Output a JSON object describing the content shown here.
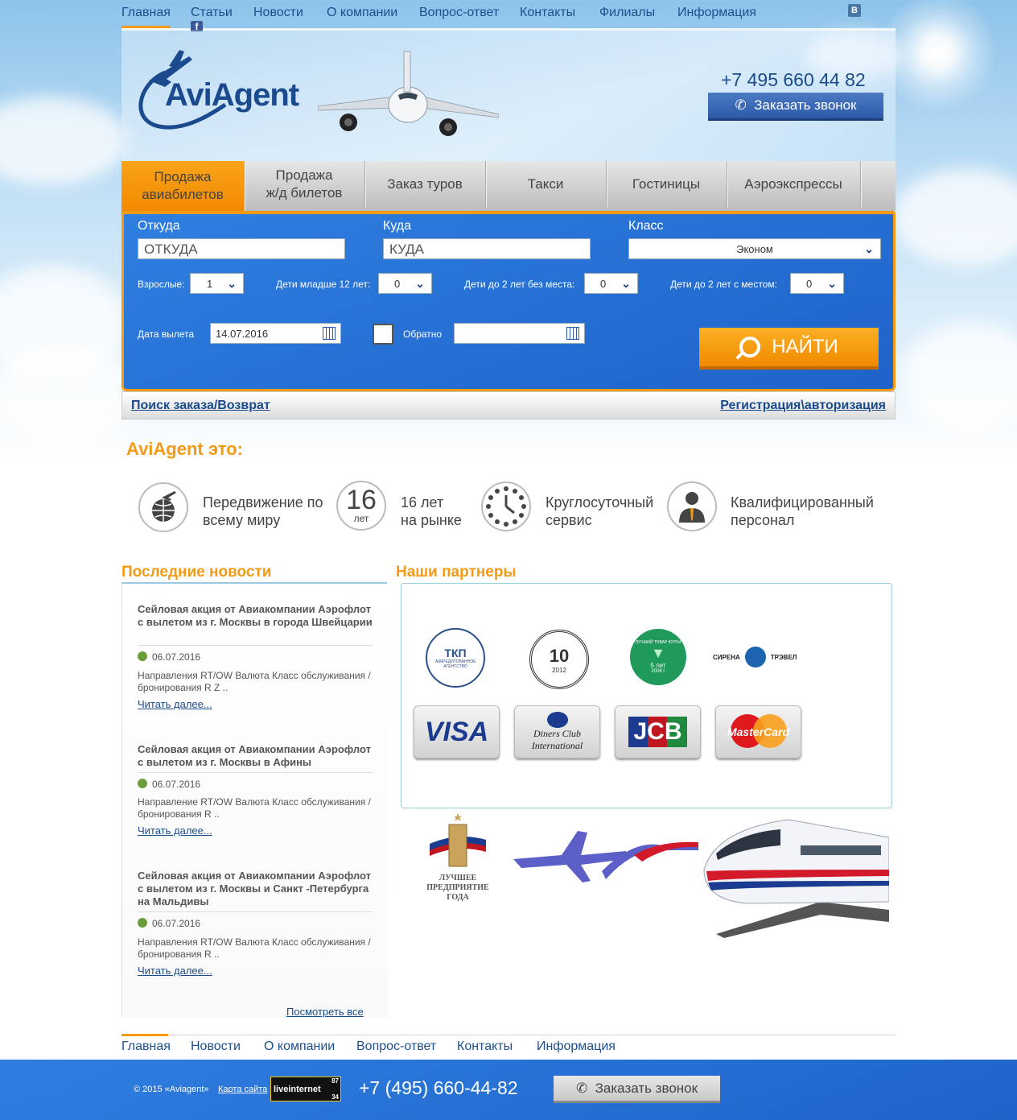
{
  "top_nav": [
    "Главная",
    "Статьи",
    "Новости",
    "О компании",
    "Вопрос-ответ",
    "Контакты",
    "Филиалы",
    "Информация"
  ],
  "social": {
    "vk": "В",
    "fb": "f"
  },
  "logo_text": "AviAgent",
  "phone": "+7 495 660 44 82",
  "callback_label": "Заказать звонок",
  "tabs": [
    {
      "line1": "Продажа",
      "line2": "авиабилетов"
    },
    {
      "line1": "Продажа",
      "line2": "ж/д билетов"
    },
    {
      "line1": "Заказ туров",
      "line2": ""
    },
    {
      "line1": "Такси",
      "line2": ""
    },
    {
      "line1": "Гостиницы",
      "line2": ""
    },
    {
      "line1": "Аэроэкспрессы",
      "line2": ""
    }
  ],
  "search": {
    "from_label": "Откуда",
    "from_placeholder": "ОТКУДА",
    "to_label": "Куда",
    "to_placeholder": "КУДА",
    "class_label": "Класс",
    "class_value": "Эконом",
    "adults_label": "Взрослые:",
    "adults_value": "1",
    "children12_label": "Дети младше 12 лет:",
    "children12_value": "0",
    "infants_noseat_label": "Дети до 2 лет без места:",
    "infants_noseat_value": "0",
    "infants_seat_label": "Дети до 2 лет с местом:",
    "infants_seat_value": "0",
    "depart_label": "Дата вылета",
    "depart_value": "14.07.2016",
    "return_label": "Обратно",
    "return_value": "",
    "find_label": "НАЙТИ"
  },
  "subbar": {
    "left": "Поиск заказа/Возврат",
    "right": "Регистрация\\авторизация"
  },
  "about_title": "AviAgent это:",
  "features": [
    {
      "line1": "Передвижение по",
      "line2": "всему миру"
    },
    {
      "line1": "16 лет",
      "line2": "на рынке",
      "icon_big": "16",
      "icon_small": "лет"
    },
    {
      "line1": "Круглосуточный",
      "line2": "сервис"
    },
    {
      "line1": "Квалифицированный",
      "line2": "персонал"
    }
  ],
  "news_title": "Последние новости",
  "news": [
    {
      "title": "Сейловая акция от Авиакомпании Аэрофлот с вылетом из г. Москвы в города Швейцарии",
      "date": "06.07.2016",
      "text": "Направления RT/OW Валюта Класс обслуживания / бронирования     R Z ..",
      "more": "Читать далее..."
    },
    {
      "title": "Сейловая акция от Авиакомпании Аэрофлот с вылетом из г. Москвы в Афины",
      "date": "06.07.2016",
      "text": "Направление RT/OW Валюта Класс обслуживания / бронирования     R     ..",
      "more": "Читать далее..."
    },
    {
      "title": "Сейловая акция от Авиакомпании Аэрофлот с вылетом из г. Москвы и Санкт -Петербурга на Мальдивы",
      "date": "06.07.2016",
      "text": "Направления RT/OW Валюта Класс обслуживания / бронирования     R     ..",
      "more": "Читать далее..."
    }
  ],
  "news_all": "Посмотреть все",
  "partners_title": "Наши партнеры",
  "partners": {
    "tkp": "ТКП",
    "tkp_sub": "АККРЕДИТОВАННОЕ АГЕНТСТВО",
    "years10": "10",
    "year2012": "2012",
    "best_goods": "5 лет",
    "best_goods_sub": "ЛУЧШИЙ ТОВАР ЮГРЫ",
    "best_goods_year": "2008 г",
    "sirena_left": "СИРЕНА",
    "sirena_right": "ТРЭВЕЛ",
    "visa": "VISA",
    "diners1": "Diners Club",
    "diners2": "International",
    "jcb": "JCB",
    "mastercard": "MasterCard",
    "best_company": "ЛУЧШЕЕ ПРЕДПРИЯТИЕ ГОДА"
  },
  "footer_nav": [
    "Главная",
    "Новости",
    "О компании",
    "Вопрос-ответ",
    "Контакты",
    "Информация"
  ],
  "footer": {
    "copyright": "© 2015 «Aviagent»",
    "sitemap": "Карта сайта",
    "liveinternet": "liveinternet",
    "li_top": "87",
    "li_bottom": "34",
    "phone": "+7 (495) 660-44-82",
    "callback": "Заказать звонок"
  },
  "colors": {
    "accent": "#f39b15",
    "brand_blue": "#1f63c8",
    "link": "#1a4b8c"
  }
}
